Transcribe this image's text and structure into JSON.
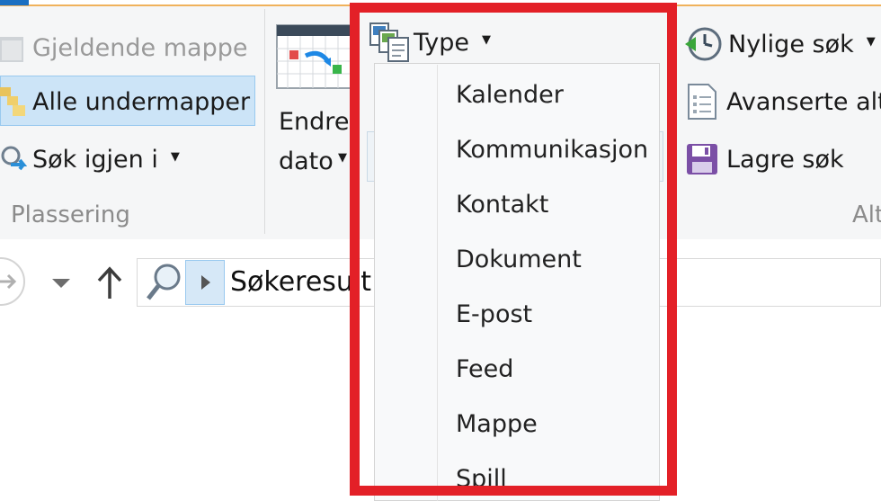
{
  "ribbon": {
    "location": {
      "current_folder_label": "Gjeldende mappe",
      "all_subfolders_label": "Alle undermapper",
      "search_again_label": "Søk igjen i",
      "group_label": "Plassering"
    },
    "refine": {
      "date_modified_line1": "Endre",
      "date_modified_line2": "dato",
      "type_label": "Type"
    },
    "options": {
      "recent_searches_label": "Nylige søk",
      "advanced_label": "Avanserte alt",
      "save_search_label": "Lagre søk",
      "group_label": "Alt"
    }
  },
  "addressbar": {
    "path_text": "Søkeresult"
  },
  "type_menu": {
    "items": [
      "Kalender",
      "Kommunikasjon",
      "Kontakt",
      "Dokument",
      "E-post",
      "Feed",
      "Mappe",
      "Spill"
    ]
  },
  "colors": {
    "highlight_border": "#e32027",
    "selection_fill": "#cce4f7",
    "selection_border": "#99c9ef"
  },
  "icons": {
    "current_folder": "folder-icon",
    "all_subfolders": "folders-icon",
    "search_again": "search-folder-icon",
    "date_modified": "calendar-icon",
    "type": "file-types-icon",
    "recent_searches": "clock-icon",
    "advanced": "document-list-icon",
    "save_search": "floppy-disk-icon",
    "forward": "forward-arrow-icon",
    "recent_locations": "chevron-down-icon",
    "up": "up-arrow-icon",
    "search": "magnifier-icon",
    "breadcrumb": "breadcrumb-arrow-icon"
  }
}
